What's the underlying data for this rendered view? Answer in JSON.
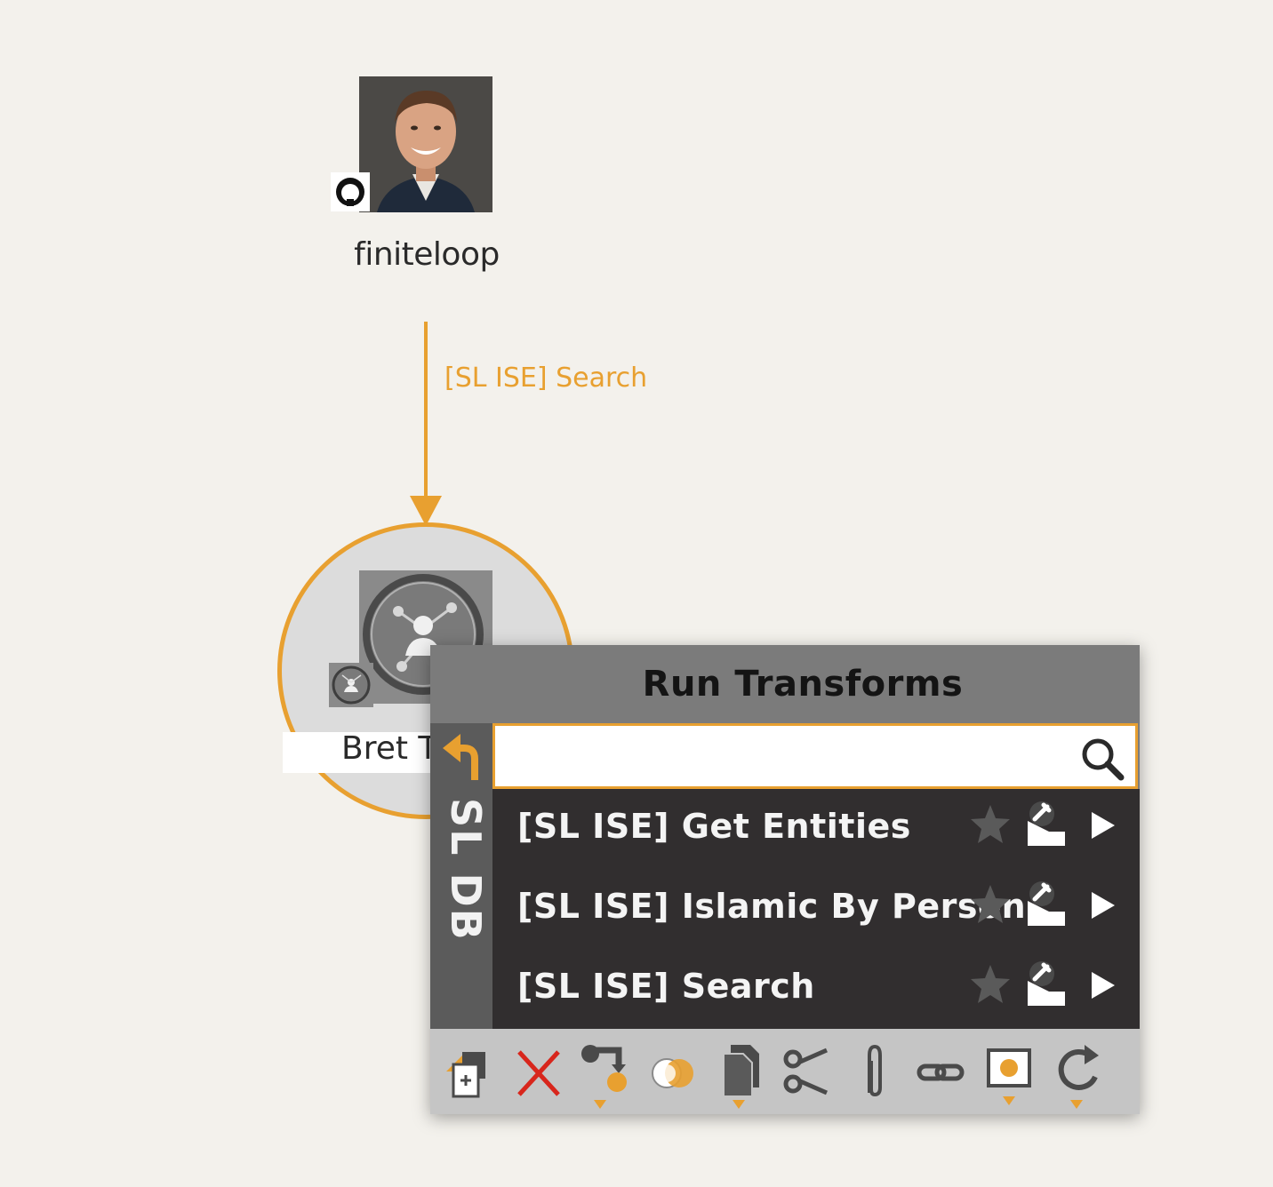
{
  "graph": {
    "top_node": {
      "label": "finiteloop",
      "badge_icon": "github-icon"
    },
    "edge": {
      "label": "[SL ISE] Search",
      "color": "#e8a030"
    },
    "selected_node": {
      "label": "Bret T",
      "icon": "social-person-icon"
    }
  },
  "menu": {
    "title": "Run Transforms",
    "side_label": "SL DB",
    "back_icon": "back-arrow-icon",
    "search": {
      "value": "",
      "placeholder": ""
    },
    "items": [
      {
        "label": "[SL ISE] Get Entities"
      },
      {
        "label": "[SL ISE] Islamic By Person"
      },
      {
        "label": "[SL ISE] Search"
      }
    ],
    "toolbar_icons": [
      "copy-to-graph-icon",
      "delete-icon",
      "change-type-icon",
      "merge-icon",
      "paste-icon",
      "cut-icon",
      "attach-icon",
      "link-icon",
      "select-icon",
      "refresh-icon"
    ]
  },
  "colors": {
    "accent": "#e8a030",
    "menu_header": "#7b7b7b",
    "menu_list": "#312e2f",
    "toolbar": "#c5c5c5",
    "background": "#f3f1ec"
  }
}
